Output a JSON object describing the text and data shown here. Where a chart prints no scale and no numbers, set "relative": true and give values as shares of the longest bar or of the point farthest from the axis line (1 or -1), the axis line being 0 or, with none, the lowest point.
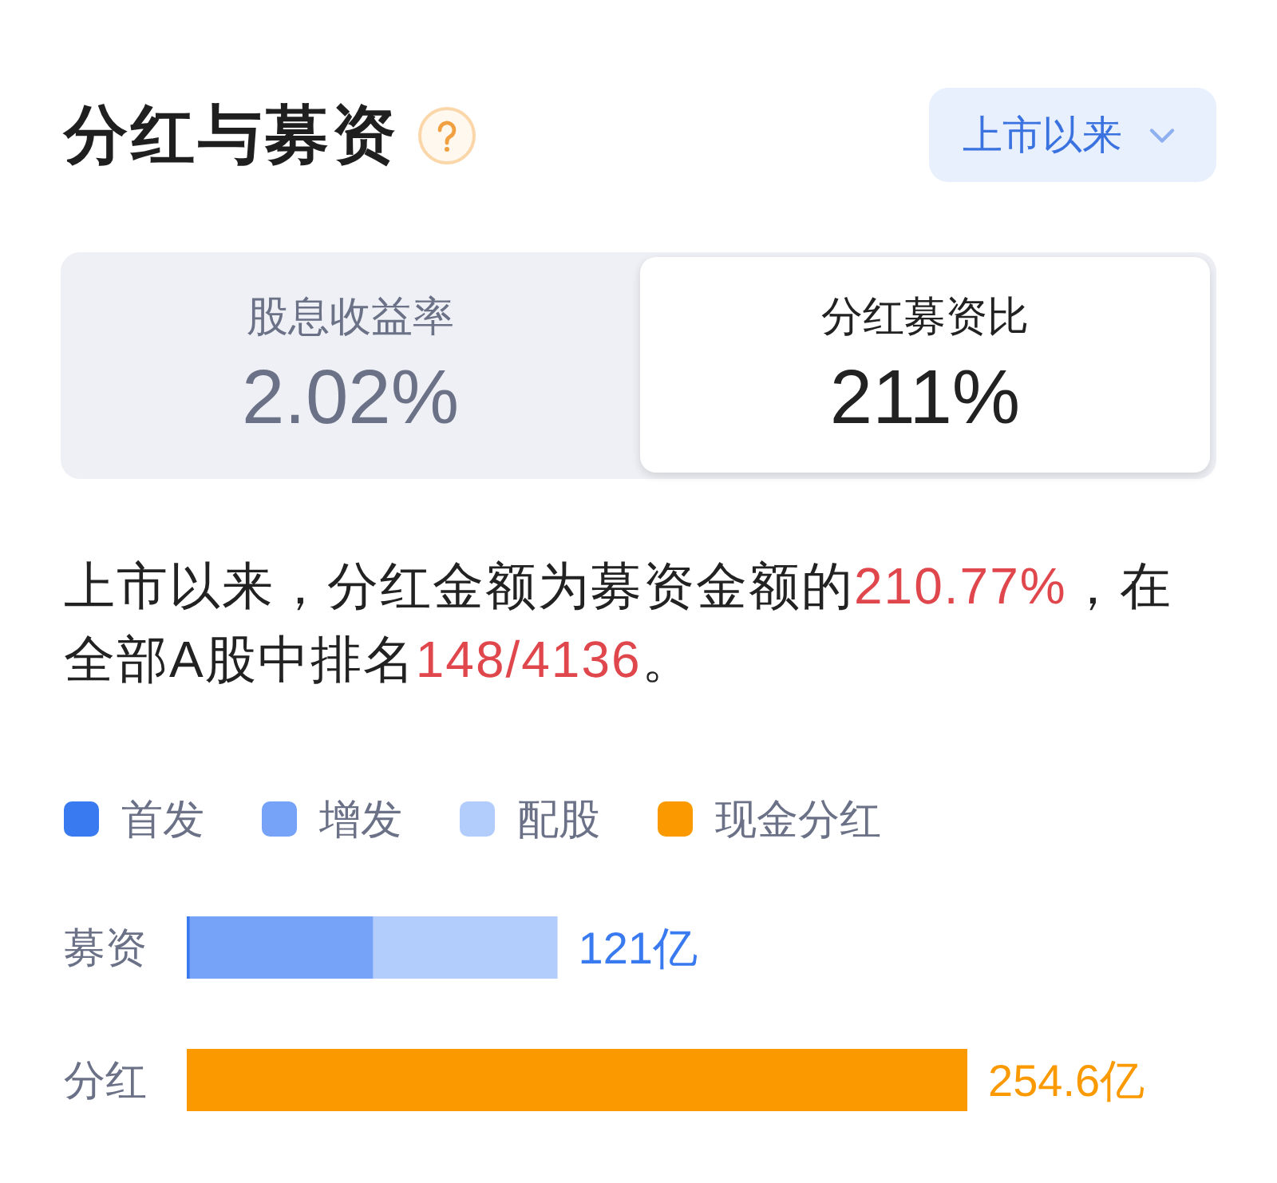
{
  "header": {
    "title": "分红与募资",
    "period_selector": {
      "label": "上市以来"
    }
  },
  "tabs": [
    {
      "label": "股息收益率",
      "value": "2.02%",
      "selected": false
    },
    {
      "label": "分红募资比",
      "value": "211%",
      "selected": true
    }
  ],
  "summary": [
    {
      "text": "上市以来，分红金额为募资金额的",
      "highlight": false
    },
    {
      "text": "210.77%",
      "highlight": true
    },
    {
      "text": "，在全部A股中排名",
      "highlight": false
    },
    {
      "text": "148/4136",
      "highlight": true
    },
    {
      "text": "。",
      "highlight": false
    }
  ],
  "chart_data": {
    "type": "bar",
    "orientation": "horizontal",
    "stacked": true,
    "relative": true,
    "legend": "top",
    "categories": [
      "募资",
      "分红"
    ],
    "series": [
      {
        "name": "首发",
        "color": "#3a7af0",
        "values": [
          0.004,
          null
        ]
      },
      {
        "name": "增发",
        "color": "#76a3f7",
        "values": [
          0.235,
          null
        ]
      },
      {
        "name": "配股",
        "color": "#b2cdfb",
        "values": [
          0.236,
          null
        ]
      },
      {
        "name": "现金分红",
        "color": "#fa9a00",
        "values": [
          null,
          1
        ]
      }
    ],
    "value_labels": [
      "121亿",
      "254.6亿"
    ]
  }
}
